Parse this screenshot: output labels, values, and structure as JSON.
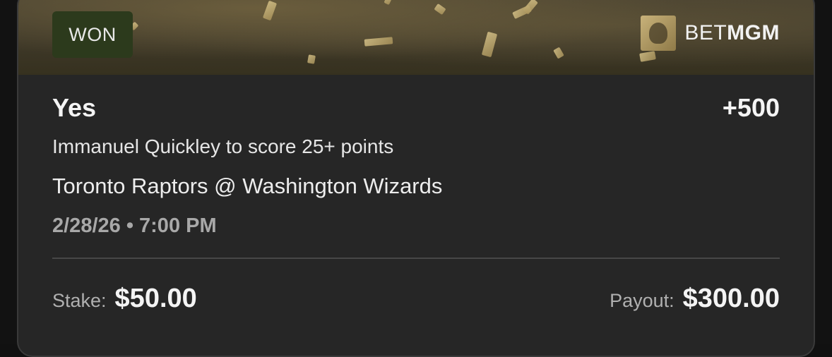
{
  "status_badge": "WON",
  "brand": {
    "prefix": "BET",
    "suffix": "MGM"
  },
  "bet": {
    "selection": "Yes",
    "odds": "+500",
    "market": "Immanuel Quickley to score 25+ points",
    "event": "Toronto Raptors @ Washington Wizards",
    "datetime": "2/28/26 • 7:00 PM"
  },
  "amounts": {
    "stake_label": "Stake:",
    "stake_value": "$50.00",
    "payout_label": "Payout:",
    "payout_value": "$300.00"
  },
  "colors": {
    "card_bg": "#262626",
    "won_badge_bg": "#2c3a1c",
    "gold_accent": "#c8b27a"
  },
  "icons": [
    "confetti-decoration",
    "betmgm-lion-icon"
  ]
}
